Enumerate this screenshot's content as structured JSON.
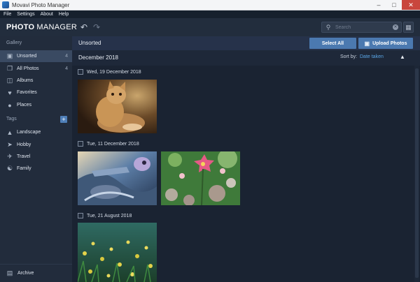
{
  "window": {
    "title": "Movavi Photo Manager"
  },
  "menu": {
    "file": "File",
    "settings": "Settings",
    "about": "About",
    "help": "Help"
  },
  "header": {
    "logo_bold": "PHOTO",
    "logo_light": "MANAGER",
    "search_placeholder": "Search"
  },
  "sidebar": {
    "gallery_title": "Gallery",
    "items": [
      {
        "label": "Unsorted",
        "count": "4",
        "icon": "image-icon"
      },
      {
        "label": "All Photos",
        "count": "4",
        "icon": "photos-icon"
      },
      {
        "label": "Albums",
        "count": "",
        "icon": "album-icon"
      },
      {
        "label": "Favorites",
        "count": "",
        "icon": "heart-icon"
      },
      {
        "label": "Places",
        "count": "",
        "icon": "pin-icon"
      }
    ],
    "tags_title": "Tags",
    "tags": [
      {
        "label": "Landscape",
        "icon": "landscape-icon"
      },
      {
        "label": "Hobby",
        "icon": "hobby-icon"
      },
      {
        "label": "Travel",
        "icon": "plane-icon"
      },
      {
        "label": "Family",
        "icon": "family-icon"
      }
    ],
    "archive_label": "Archive"
  },
  "toolbar": {
    "title": "Unsorted",
    "select_all": "Select All",
    "upload": "Upload Photos"
  },
  "main": {
    "month": "December 2018",
    "sort_by_label": "Sort by:",
    "sort_by_value": "Date taken",
    "groups": [
      {
        "date": "Wed, 19 December 2018"
      },
      {
        "date": "Tue, 11 December 2018"
      },
      {
        "date": "Tue, 21 August 2018"
      }
    ]
  },
  "colors": {
    "accent": "#4b79b0",
    "link": "#5aa6e6",
    "sidebar_active": "#3a4a62",
    "background": "#1a2332"
  }
}
